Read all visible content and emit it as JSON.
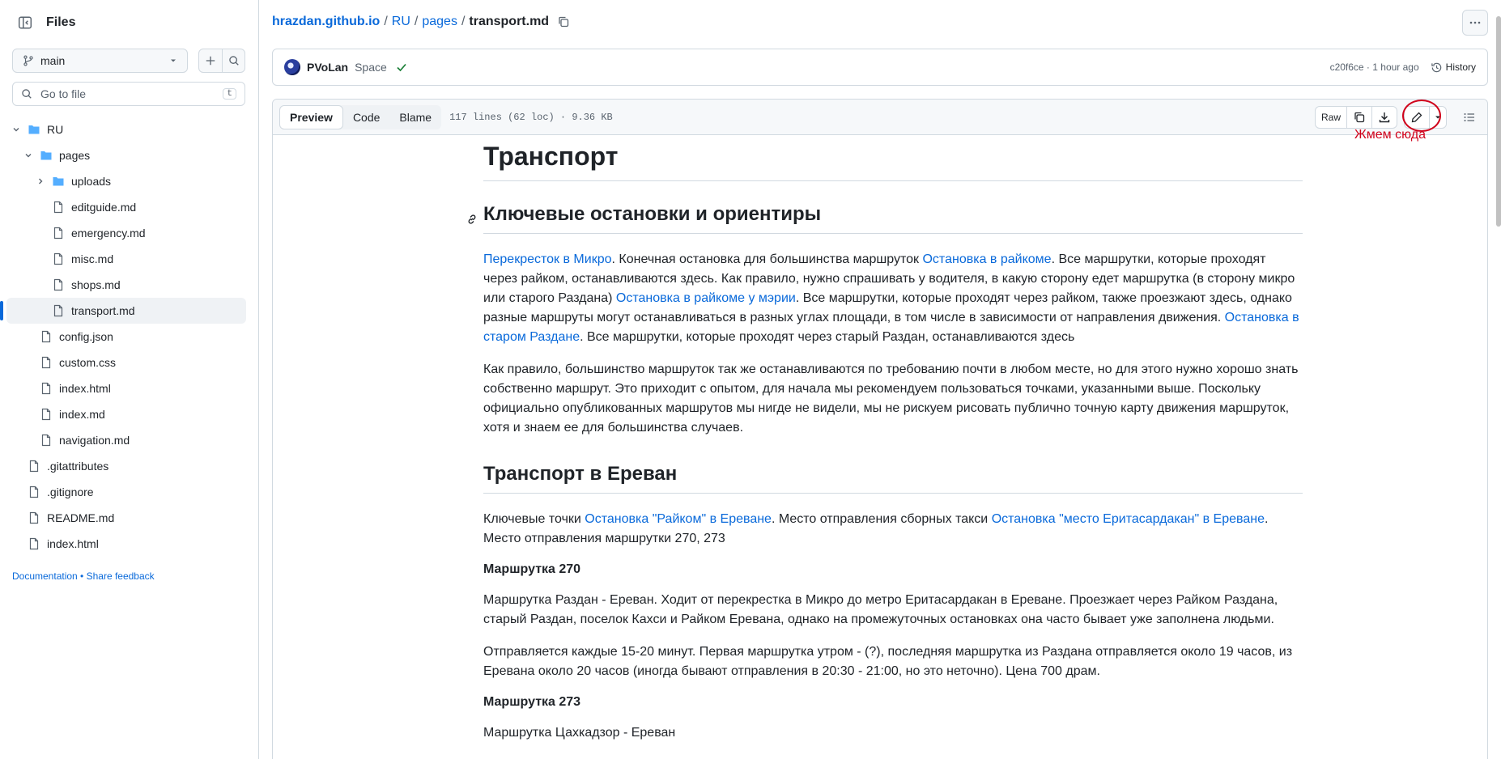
{
  "sidebar": {
    "title": "Files",
    "branch": "main",
    "goto_placeholder": "Go to file",
    "goto_shortcut": "t",
    "tree": [
      {
        "label": "RU",
        "kind": "folder",
        "depth": 0,
        "expanded": true
      },
      {
        "label": "pages",
        "kind": "folder",
        "depth": 1,
        "expanded": true
      },
      {
        "label": "uploads",
        "kind": "folder",
        "depth": 2,
        "expanded": false
      },
      {
        "label": "editguide.md",
        "kind": "file",
        "depth": 2
      },
      {
        "label": "emergency.md",
        "kind": "file",
        "depth": 2
      },
      {
        "label": "misc.md",
        "kind": "file",
        "depth": 2
      },
      {
        "label": "shops.md",
        "kind": "file",
        "depth": 2
      },
      {
        "label": "transport.md",
        "kind": "file",
        "depth": 2,
        "selected": true
      },
      {
        "label": "config.json",
        "kind": "file",
        "depth": 1
      },
      {
        "label": "custom.css",
        "kind": "file",
        "depth": 1
      },
      {
        "label": "index.html",
        "kind": "file",
        "depth": 1
      },
      {
        "label": "index.md",
        "kind": "file",
        "depth": 1
      },
      {
        "label": "navigation.md",
        "kind": "file",
        "depth": 1
      },
      {
        "label": ".gitattributes",
        "kind": "file",
        "depth": 0
      },
      {
        "label": ".gitignore",
        "kind": "file",
        "depth": 0
      },
      {
        "label": "README.md",
        "kind": "file",
        "depth": 0
      },
      {
        "label": "index.html",
        "kind": "file",
        "depth": 0
      }
    ],
    "footer": {
      "docs": "Documentation",
      "sep": " • ",
      "feedback": "Share feedback"
    }
  },
  "breadcrumb": {
    "repo": "hrazdan.github.io",
    "p1": "RU",
    "p2": "pages",
    "file": "transport.md",
    "sep": "/"
  },
  "commit": {
    "author": "PVoLan",
    "message": "Space",
    "hash": "c20f6ce",
    "dot": " · ",
    "time": "1 hour ago",
    "history": "History"
  },
  "file_header": {
    "tabs": [
      "Preview",
      "Code",
      "Blame"
    ],
    "active_tab": "Preview",
    "info": "117 lines (62 loc) · 9.36 KB",
    "raw": "Raw"
  },
  "annotation": "Жмем сюда",
  "article": {
    "h1": "Транспорт",
    "h2a": "Ключевые остановки и ориентиры",
    "p1": [
      {
        "link": true,
        "text": "Перекресток в Микро"
      },
      {
        "link": false,
        "text": ". Конечная остановка для большинства маршруток "
      },
      {
        "link": true,
        "text": "Остановка в райкоме"
      },
      {
        "link": false,
        "text": ". Все маршрутки, которые проходят через райком, останавливаются здесь. Как правило, нужно спрашивать у водителя, в какую сторону едет маршрутка (в сторону микро или старого Раздана) "
      },
      {
        "link": true,
        "text": "Остановка в райкоме у мэрии"
      },
      {
        "link": false,
        "text": ". Все маршрутки, которые проходят через райком, также проезжают здесь, однако разные маршруты могут останавливаться в разных углах площади, в том числе в зависимости от направления движения. "
      },
      {
        "link": true,
        "text": "Остановка в старом Раздане"
      },
      {
        "link": false,
        "text": ". Все маршрутки, которые проходят через старый Раздан, останавливаются здесь"
      }
    ],
    "p2": "Как правило, большинство маршруток так же останавливаются по требованию почти в любом месте, но для этого нужно хорошо знать собственно маршрут. Это приходит с опытом, для начала мы рекомендуем пользоваться точками, указанными выше. Поскольку официально опубликованных маршрутов мы нигде не видели, мы не рискуем рисовать публично точную карту движения маршруток, хотя и знаем ее для большинства случаев.",
    "h2b": "Транспорт в Ереван",
    "p3": [
      {
        "link": false,
        "text": "Ключевые точки "
      },
      {
        "link": true,
        "text": "Остановка \"Райком\" в Ереване"
      },
      {
        "link": false,
        "text": ". Место отправления сборных такси "
      },
      {
        "link": true,
        "text": "Остановка \"место Еритасардакан\" в Ереване"
      },
      {
        "link": false,
        "text": ". Место отправления маршрутки 270, 273"
      }
    ],
    "h3a": "Маршрутка 270",
    "p4": "Маршрутка Раздан - Ереван. Ходит от перекрестка в Микро до метро Еритасардакан в Ереване. Проезжает через Райком Раздана, старый Раздан, поселок Кахси и Райком Еревана, однако на промежуточных остановках она часто бывает уже заполнена людьми.",
    "p5": "Отправляется каждые 15-20 минут. Первая маршрутка утром - (?), последняя маршрутка из Раздана отправляется около 19 часов, из Еревана около 20 часов (иногда бывают отправления в 20:30 - 21:00, но это неточно). Цена 700 драм.",
    "h3b": "Маршрутка 273",
    "p6": "Маршрутка Цахкадзор - Ереван"
  }
}
